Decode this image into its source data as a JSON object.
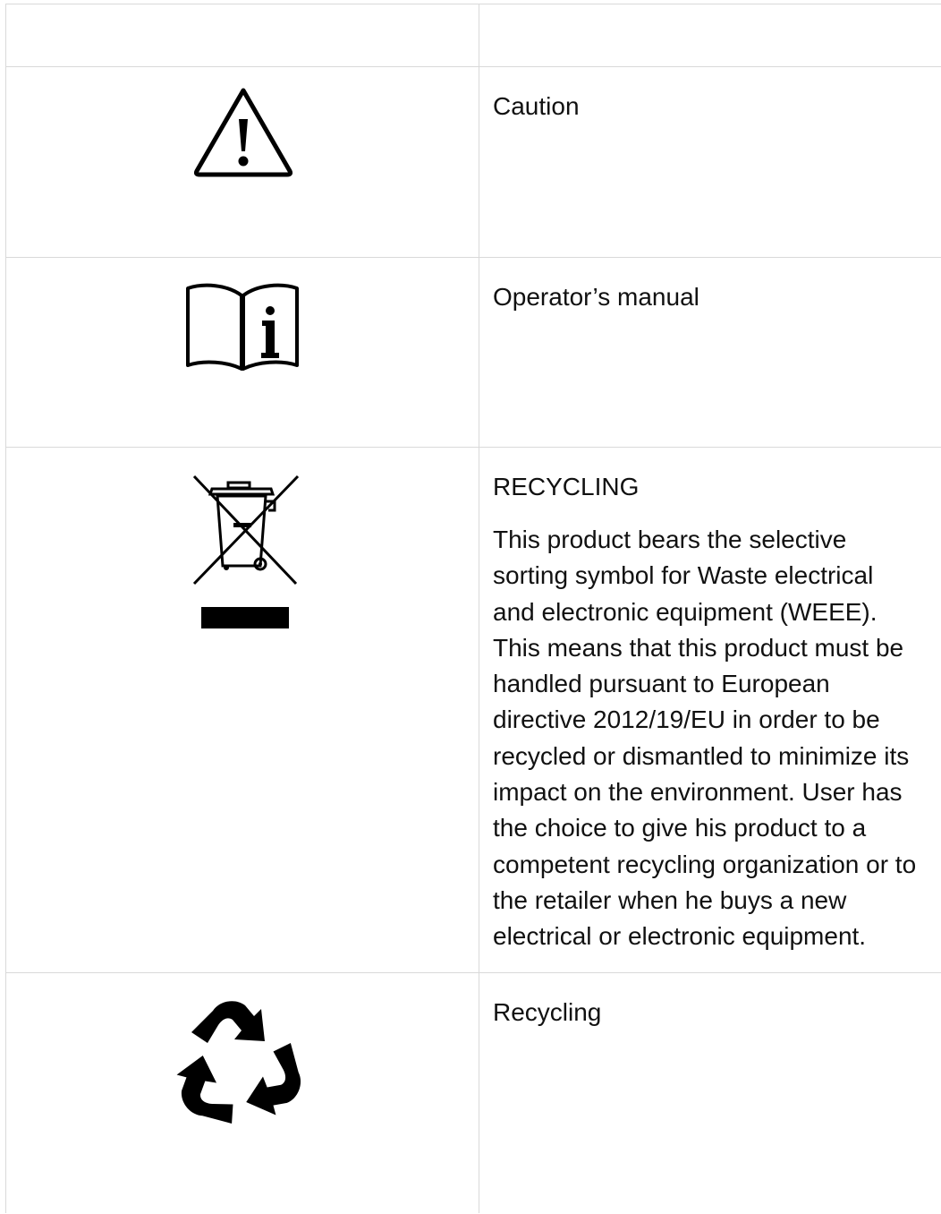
{
  "rows": [
    {
      "title": ""
    },
    {
      "title": "Caution",
      "icon": "warning-triangle-icon"
    },
    {
      "title": "Operator’s manual",
      "icon": "operator-manual-book-icon"
    },
    {
      "title": "RECYCLING",
      "icon": "crossed-out-wheelie-bin-weee-icon",
      "body": "This product bears the selective\nsorting symbol for Waste electrical\nand electronic  equipment (WEEE).\nThis means that this product must be\nhandled pursuant to European\ndirective 2012/19/EU in order to be\nrecycled or dismantled to minimize its\nimpact on  the environment. User has\nthe choice to give his product to a\ncompetent recycling organization or to\nthe  retailer when he buys a new\nelectrical or electronic equipment."
    },
    {
      "title": "Recycling",
      "icon": "recycling-arrows-icon"
    }
  ]
}
